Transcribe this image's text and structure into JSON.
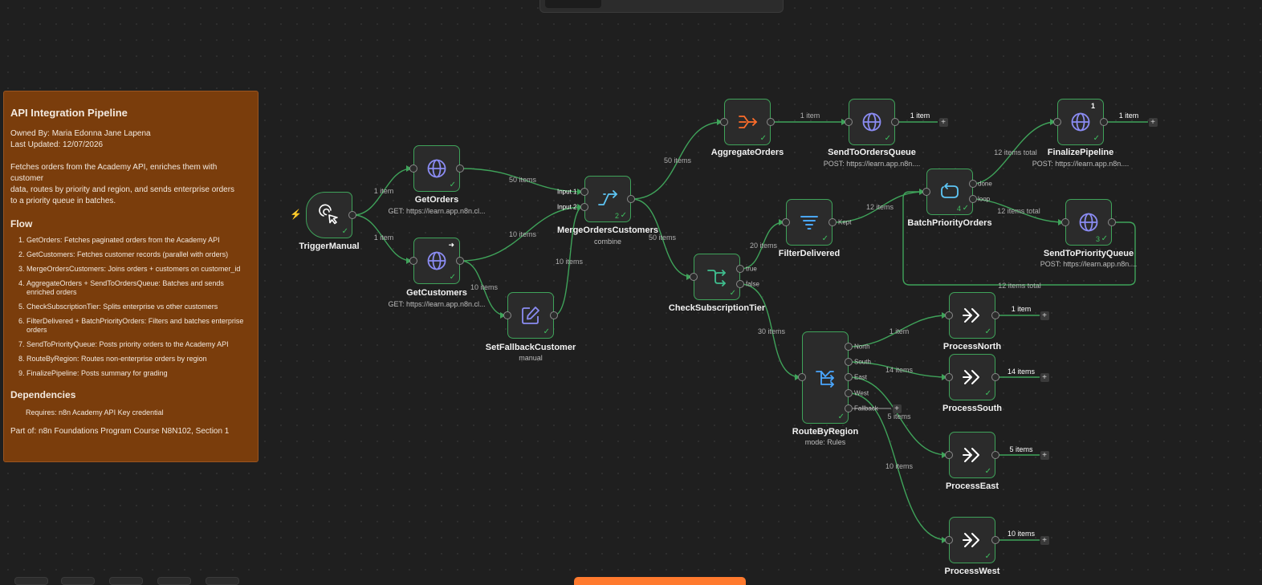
{
  "workflow": {
    "nodes": {
      "trigger": {
        "name": "TriggerManual",
        "icon": "cursor-click-icon"
      },
      "get_orders": {
        "name": "GetOrders",
        "subtitle": "GET: https://learn.app.n8n.cl...",
        "icon": "globe-icon"
      },
      "get_customers": {
        "name": "GetCustomers",
        "subtitle": "GET: https://learn.app.n8n.cl...",
        "icon": "globe-icon"
      },
      "set_fallback": {
        "name": "SetFallbackCustomer",
        "subtitle": "manual",
        "icon": "pencil-icon"
      },
      "merge": {
        "name": "MergeOrdersCustomers",
        "subtitle": "combine",
        "count": "2",
        "input1": "Input 1",
        "input2": "Input 2",
        "icon": "merge-icon"
      },
      "aggregate": {
        "name": "AggregateOrders",
        "icon": "aggregate-icon"
      },
      "send_orders": {
        "name": "SendToOrdersQueue",
        "subtitle": "POST: https://learn.app.n8n....",
        "icon": "globe-icon"
      },
      "check_tier": {
        "name": "CheckSubscriptionTier",
        "true_label": "true",
        "false_label": "false",
        "icon": "if-icon"
      },
      "filter_delivered": {
        "name": "FilterDelivered",
        "kept_label": "Kept",
        "icon": "filter-icon"
      },
      "batch_priority": {
        "name": "BatchPriorityOrders",
        "count": "4",
        "done_label": "done",
        "loop_label": "loop",
        "icon": "loop-icon"
      },
      "finalize": {
        "name": "FinalizePipeline",
        "subtitle": "POST: https://learn.app.n8n....",
        "badge": "1",
        "icon": "globe-icon"
      },
      "send_priority": {
        "name": "SendToPriorityQueue",
        "subtitle": "POST: https://learn.app.n8n....",
        "count": "3",
        "icon": "globe-icon"
      },
      "route_region": {
        "name": "RouteByRegion",
        "subtitle": "mode: Rules",
        "outputs": [
          "North",
          "South",
          "East",
          "West",
          "Fallback"
        ],
        "icon": "switch-icon"
      },
      "process_north": {
        "name": "ProcessNorth",
        "icon": "double-chevron-icon"
      },
      "process_south": {
        "name": "ProcessSouth",
        "icon": "double-chevron-icon"
      },
      "process_east": {
        "name": "ProcessEast",
        "icon": "double-chevron-icon"
      },
      "process_west": {
        "name": "ProcessWest",
        "icon": "double-chevron-icon"
      }
    },
    "edge_labels": {
      "trigger_orders": "1 item",
      "trigger_customers": "1 item",
      "orders_merge": "50 items",
      "customers_merge": "10 items",
      "customers_fallback": "10 items",
      "fallback_merge": "10 items",
      "merge_aggregate": "50 items",
      "merge_check": "50 items",
      "aggregate_send": "1 item",
      "send_orders_out": "1 item",
      "check_filter": "20 items",
      "check_route": "30 items",
      "filter_batch": "12 items",
      "batch_finalize": "12 items total",
      "batch_priority": "12 items total",
      "priority_loop": "12 items total",
      "finalize_out": "1 item",
      "route_north": "1 item",
      "route_south": "14 items",
      "route_east": "5 items",
      "route_west": "10 items",
      "north_out": "1 item",
      "south_out": "14 items",
      "east_out": "5 items",
      "west_out": "10 items"
    },
    "plus_symbol": "+",
    "check_symbol": "✓"
  },
  "sticky_note": {
    "title": "API Integration Pipeline",
    "owner": "Owned By: Maria Edonna Jane Lapena",
    "updated": "Last Updated: 12/07/2026",
    "description_lines": [
      "Fetches orders from the Academy API, enriches them with",
      "customer",
      "data, routes by priority and region, and sends enterprise orders",
      "to a priority queue in batches."
    ],
    "flow_heading": "Flow",
    "flow_items": [
      "GetOrders: Fetches paginated orders from the Academy API",
      "GetCustomers: Fetches customer records (parallel with orders)",
      "MergeOrdersCustomers: Joins orders + customers on customer_id",
      "AggregateOrders + SendToOrdersQueue: Batches and sends enriched orders",
      "CheckSubscriptionTier: Splits enterprise vs other customers",
      "FilterDelivered + BatchPriorityOrders: Filters and batches enterprise orders",
      "SendToPriorityQueue: Posts priority orders to the Academy API",
      "RouteByRegion: Routes non-enterprise orders by region",
      "FinalizePipeline: Posts summary for grading"
    ],
    "dependencies_heading": "Dependencies",
    "dependency": "Requires: n8n Academy API Key credential",
    "part_of": "Part of: n8n Foundations Program Course N8N102, Section 1"
  },
  "colors": {
    "canvas": "#1f1f1f",
    "edge_success": "#3fa35a",
    "node_fill": "#2b2b2b",
    "sticky": "#7a3d0c",
    "globe_icon": "#8b8cf3",
    "aggregate_icon": "#ff6d2a",
    "merge_icon": "#5ec6f5",
    "filter_icon": "#4aa7ff",
    "trigger_bolt": "#ff6d2a"
  }
}
